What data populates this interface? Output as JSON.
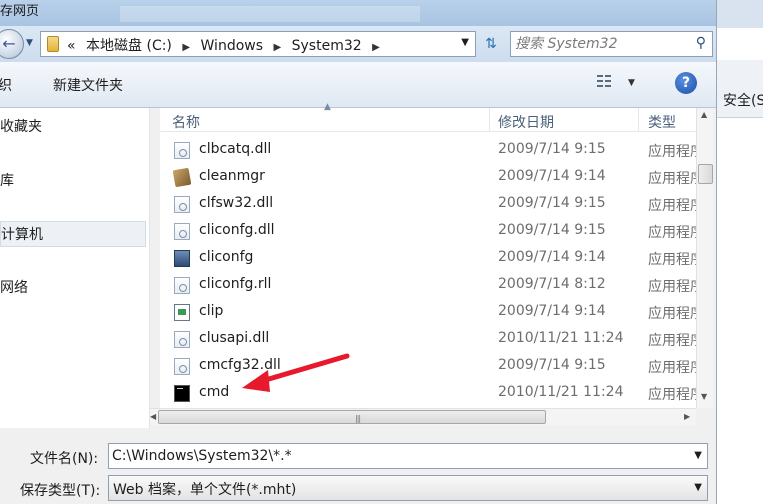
{
  "window": {
    "title_fragment": "存网页"
  },
  "address_bar": {
    "prefix": "«",
    "crumbs": [
      "本地磁盘 (C:)",
      "Windows",
      "System32"
    ],
    "search_placeholder": "搜索 System32"
  },
  "toolbar": {
    "organize_label": "织",
    "new_folder_label": "新建文件夹"
  },
  "nav_pane": {
    "items": [
      "收藏夹",
      "库",
      "计算机",
      "网络"
    ],
    "selected_index": 2
  },
  "right_edge": {
    "tab_text": "安全(S"
  },
  "columns": {
    "name": "名称",
    "date": "修改日期",
    "type": "类型"
  },
  "files": [
    {
      "name": "clbcatq.dll",
      "date": "2009/7/14 9:15",
      "type": "应用程序扩展",
      "icon": "dll-file-icon"
    },
    {
      "name": "cleanmgr",
      "date": "2009/7/14 9:14",
      "type": "应用程序",
      "icon": "cleanmgr-icon"
    },
    {
      "name": "clfsw32.dll",
      "date": "2009/7/14 9:15",
      "type": "应用程序扩展",
      "icon": "dll-file-icon"
    },
    {
      "name": "cliconfg.dll",
      "date": "2009/7/14 9:15",
      "type": "应用程序扩展",
      "icon": "dll-file-icon"
    },
    {
      "name": "cliconfg",
      "date": "2009/7/14 9:14",
      "type": "应用程序",
      "icon": "cliconfg-icon"
    },
    {
      "name": "cliconfg.rll",
      "date": "2009/7/14 8:12",
      "type": "应用程序扩展",
      "icon": "dll-file-icon"
    },
    {
      "name": "clip",
      "date": "2009/7/14 9:14",
      "type": "应用程序",
      "icon": "clip-icon"
    },
    {
      "name": "clusapi.dll",
      "date": "2010/11/21 11:24",
      "type": "应用程序扩展",
      "icon": "dll-file-icon"
    },
    {
      "name": "cmcfg32.dll",
      "date": "2009/7/14 9:15",
      "type": "应用程序扩展",
      "icon": "dll-file-icon"
    },
    {
      "name": "cmd",
      "date": "2010/11/21 11:24",
      "type": "应用程序",
      "icon": "cmd-icon"
    }
  ],
  "file_name": {
    "label": "文件名(N):",
    "value": "C:\\Windows\\System32\\*.*"
  },
  "save_type": {
    "label": "保存类型(T):",
    "value": "Web 档案，单个文件(*.mht)"
  },
  "colors": {
    "annotation_arrow": "#e8192c",
    "selection": "#edf1f6"
  }
}
